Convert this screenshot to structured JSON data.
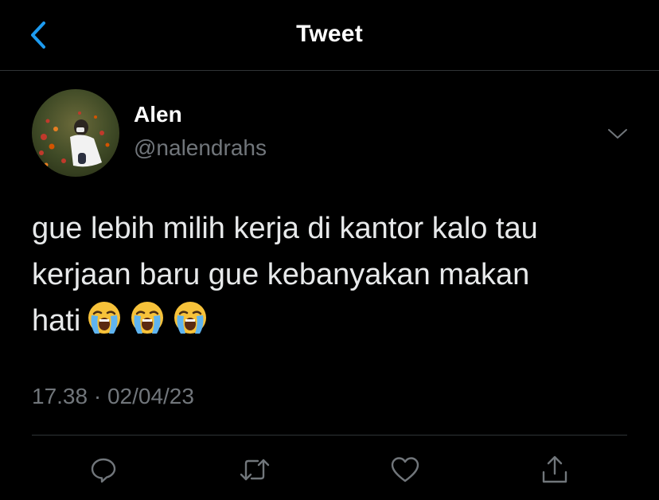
{
  "header": {
    "title": "Tweet",
    "back_icon": "chevron-left-icon"
  },
  "tweet": {
    "author_name": "Alen",
    "author_handle": "@nalendrahs",
    "text_line1": "gue lebih milih kerja di kantor kalo tau",
    "text_line2": "kerjaan baru gue kebanyakan makan",
    "text_line3": "hati",
    "emojis": [
      "loudly-crying-face",
      "loudly-crying-face",
      "loudly-crying-face"
    ],
    "timestamp": "17.38 · 02/04/23"
  },
  "actions": {
    "reply_icon": "reply-icon",
    "retweet_icon": "retweet-icon",
    "like_icon": "heart-icon",
    "share_icon": "share-icon"
  },
  "colors": {
    "background": "#000000",
    "accent": "#1d9bf0",
    "text_primary": "#e7e9ea",
    "text_secondary": "#71767b",
    "divider": "#2f3336"
  }
}
